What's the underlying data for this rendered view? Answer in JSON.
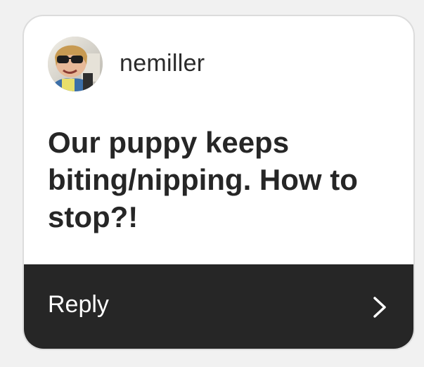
{
  "post": {
    "username": "nemiller",
    "question": "Our puppy keeps\nbiting/nipping.  How to\nstop?!",
    "reply_label": "Reply"
  },
  "icons": {
    "avatar": "user-avatar-photo",
    "reply_arrow": "chevron-right-icon"
  },
  "colors": {
    "reply_bar": "#262626",
    "card_background": "#ffffff",
    "page_background": "#f1f1f1"
  }
}
